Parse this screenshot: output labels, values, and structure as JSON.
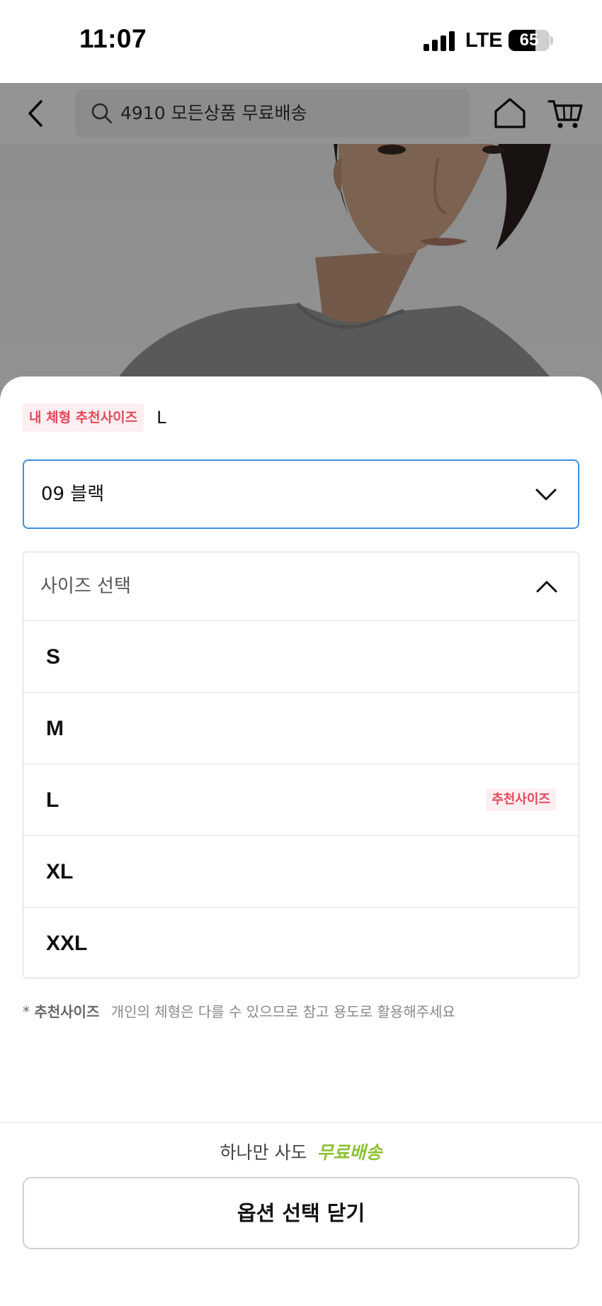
{
  "status_bar": {
    "time": "11:07",
    "network": "LTE",
    "battery": "65",
    "battery_level": 0.65
  },
  "header": {
    "search_text": "4910 모든상품 무료배송",
    "icons": [
      "back-icon",
      "search-icon",
      "home-icon",
      "cart-icon"
    ]
  },
  "sheet": {
    "recommend_badge": "내 체형 추천사이즈",
    "recommend_value": "L",
    "color_select": {
      "value": "09 블랙"
    },
    "size_select": {
      "placeholder": "사이즈 선택",
      "options": [
        {
          "label": "S"
        },
        {
          "label": "M"
        },
        {
          "label": "L",
          "tag": "추천사이즈"
        },
        {
          "label": "XL"
        },
        {
          "label": "XXL"
        }
      ]
    },
    "footnote": {
      "star": "*",
      "strong": "추천사이즈",
      "text": "개인의 체형은 다를 수 있으므로 참고 용도로 활용해주세요"
    }
  },
  "bottom": {
    "promo_prefix": "하나만 사도",
    "promo_highlight": "무료배송",
    "close_label": "옵션 선택 닫기"
  },
  "colors": {
    "accent_blue": "#3d8fe0",
    "recommend_red": "#e5475a",
    "promo_green": "#8cc232"
  }
}
